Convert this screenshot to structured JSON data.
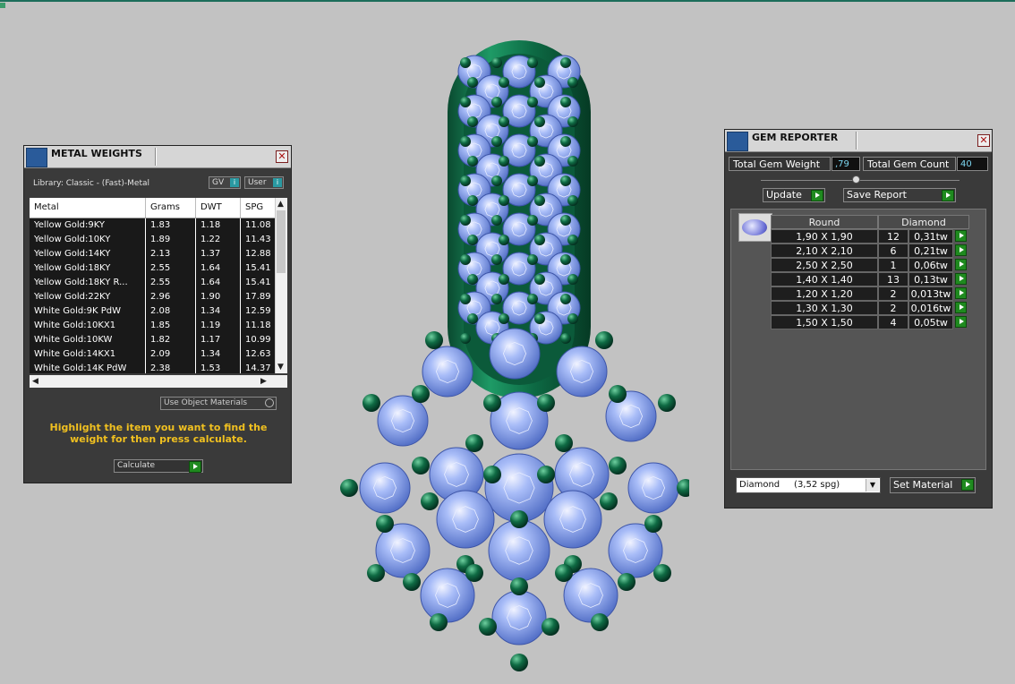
{
  "metal_weights": {
    "title": "METAL WEIGHTS",
    "close": "✕",
    "library": "Library: Classic - (Fast)-Metal",
    "gv_label": "GV",
    "user_label": "User",
    "columns": [
      "Metal",
      "Grams",
      "DWT",
      "SPG"
    ],
    "rows": [
      {
        "metal": "Yellow Gold:9KY",
        "grams": "1.83",
        "dwt": "1.18",
        "spg": "11.08"
      },
      {
        "metal": "Yellow Gold:10KY",
        "grams": "1.89",
        "dwt": "1.22",
        "spg": "11.43"
      },
      {
        "metal": "Yellow Gold:14KY",
        "grams": "2.13",
        "dwt": "1.37",
        "spg": "12.88"
      },
      {
        "metal": "Yellow Gold:18KY",
        "grams": "2.55",
        "dwt": "1.64",
        "spg": "15.41"
      },
      {
        "metal": "Yellow Gold:18KY R...",
        "grams": "2.55",
        "dwt": "1.64",
        "spg": "15.41"
      },
      {
        "metal": "Yellow Gold:22KY",
        "grams": "2.96",
        "dwt": "1.90",
        "spg": "17.89"
      },
      {
        "metal": "White Gold:9K PdW",
        "grams": "2.08",
        "dwt": "1.34",
        "spg": "12.59"
      },
      {
        "metal": "White Gold:10KX1",
        "grams": "1.85",
        "dwt": "1.19",
        "spg": "11.18"
      },
      {
        "metal": "White Gold:10KW",
        "grams": "1.82",
        "dwt": "1.17",
        "spg": "10.99"
      },
      {
        "metal": "White Gold:14KX1",
        "grams": "2.09",
        "dwt": "1.34",
        "spg": "12.63"
      },
      {
        "metal": "White Gold:14K PdW",
        "grams": "2.38",
        "dwt": "1.53",
        "spg": "14.37"
      }
    ],
    "use_object_materials": "Use Object Materials",
    "hint": "Highlight the item you want to find the weight for then press calculate.",
    "calculate": "Calculate"
  },
  "gem_reporter": {
    "title": "GEM REPORTER",
    "close": "✕",
    "total_gem_weight_label": "Total Gem Weight",
    "total_gem_weight": ",79",
    "total_gem_count_label": "Total Gem Count",
    "total_gem_count": "40",
    "update": "Update",
    "save_report": "Save Report",
    "header_shape": "Round",
    "header_material": "Diamond",
    "gems": [
      {
        "size": "1,90 X 1,90",
        "count": "12",
        "weight": "0,31tw"
      },
      {
        "size": "2,10 X 2,10",
        "count": "6",
        "weight": "0,21tw"
      },
      {
        "size": "2,50 X 2,50",
        "count": "1",
        "weight": "0,06tw"
      },
      {
        "size": "1,40 X 1,40",
        "count": "13",
        "weight": "0,13tw"
      },
      {
        "size": "1,20 X 1,20",
        "count": "2",
        "weight": "0,013tw"
      },
      {
        "size": "1,30 X 1,30",
        "count": "2",
        "weight": "0,016tw"
      },
      {
        "size": "1,50 X 1,50",
        "count": "4",
        "weight": "0,05tw"
      }
    ],
    "material_select": "Diamond     (3,52 spg)",
    "set_material": "Set Material"
  },
  "icons": [
    "metal-weights-icon",
    "gem-reporter-icon",
    "close-icon",
    "play-arrow-icon",
    "dropdown-arrow-icon"
  ],
  "colors": {
    "viewport": "#c2c2c2",
    "metal_green": "#0e5a3e",
    "gem_blue": "#8aa8f0",
    "hint_yellow": "#f0c020",
    "accent_teal": "#2a9aa2"
  }
}
